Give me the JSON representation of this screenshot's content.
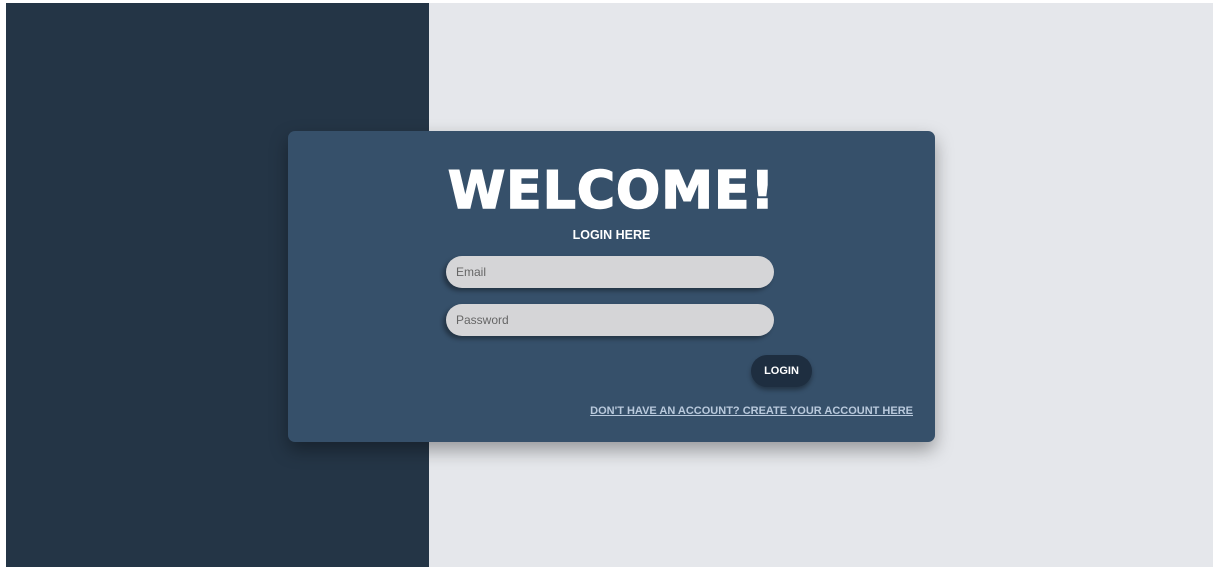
{
  "card": {
    "title": "WELCOME!",
    "subtitle": "LOGIN HERE"
  },
  "form": {
    "email_placeholder": "Email",
    "email_value": "",
    "password_placeholder": "Password",
    "password_value": "",
    "login_label": "LOGIN"
  },
  "signup": {
    "link_text": "DON'T HAVE AN ACCOUNT? CREATE YOUR ACCOUNT HERE"
  },
  "colors": {
    "left_panel": "#243546",
    "right_panel": "#e5e7eb",
    "card": "#36506a",
    "input_bg": "#d5d5d7",
    "button_bg": "#1e2e40",
    "link": "#b9c9dc"
  }
}
